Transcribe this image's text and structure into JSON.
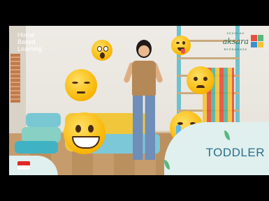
{
  "brand": {
    "hbl_lines": [
      "Home",
      "Based",
      "Learning"
    ],
    "aksara_small": "SEKOLAH",
    "aksara_word": "aksara",
    "aksara_sub": "BERBAHASA"
  },
  "badge": {
    "level": "TODDLER"
  },
  "icons": {
    "emojis": [
      "screaming-face-icon",
      "winking-tongue-face-icon",
      "pensive-face-icon",
      "angry-face-icon",
      "grinning-face-icon",
      "crying-face-icon"
    ],
    "flag": "indonesia-flag-icon"
  },
  "colors": {
    "emoji": "#f7b500",
    "toddler_text": "#2c6e8a",
    "panel": "#dff0ee"
  }
}
